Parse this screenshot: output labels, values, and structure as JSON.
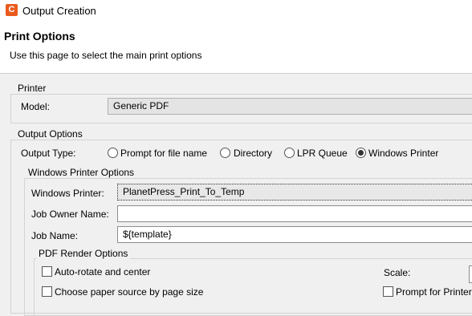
{
  "window": {
    "title": "Output Creation",
    "icon_letter": "C",
    "icon_color": "#ea5a1c"
  },
  "header": {
    "title": "Print Options",
    "subtitle": "Use this page to select the main print options"
  },
  "printer": {
    "legend": "Printer",
    "model_label": "Model:",
    "model_value": "Generic PDF"
  },
  "output_options": {
    "legend": "Output Options",
    "type_label": "Output Type:",
    "types": [
      {
        "label": "Prompt for file name",
        "checked": false
      },
      {
        "label": "Directory",
        "checked": false
      },
      {
        "label": "LPR Queue",
        "checked": false
      },
      {
        "label": "Windows Printer",
        "checked": true
      }
    ]
  },
  "windows_printer_options": {
    "legend": "Windows Printer Options",
    "printer_label": "Windows Printer:",
    "printer_value": "PlanetPress_Print_To_Temp",
    "job_owner_label": "Job Owner Name:",
    "job_owner_value": "",
    "job_name_label": "Job Name:",
    "job_name_value": "${template}"
  },
  "pdf_render_options": {
    "legend": "PDF Render Options",
    "auto_rotate_label": "Auto-rotate and center",
    "auto_rotate_checked": false,
    "paper_source_label": "Choose paper source by page size",
    "paper_source_checked": false,
    "scale_label": "Scale:",
    "prompt_label": "Prompt for Printer",
    "prompt_checked": false
  }
}
